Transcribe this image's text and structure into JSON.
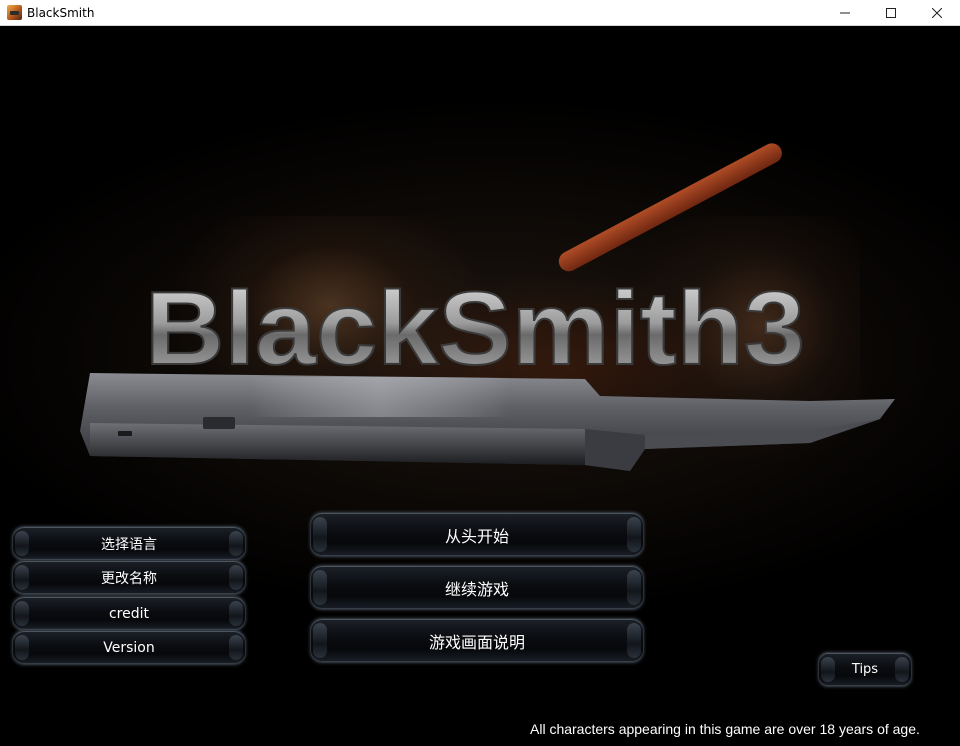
{
  "window": {
    "title": "BlackSmith",
    "app_icon": "blacksmith-app-icon",
    "controls": {
      "minimize_icon": "minimize-icon",
      "maximize_icon": "maximize-icon",
      "close_icon": "close-icon"
    }
  },
  "game": {
    "logo": "BlackSmith3",
    "left_menu": [
      {
        "label": "选择语言"
      },
      {
        "label": "更改名称"
      },
      {
        "label": "credit"
      },
      {
        "label": "Version"
      }
    ],
    "main_menu": [
      {
        "label": "从头开始"
      },
      {
        "label": "继续游戏"
      },
      {
        "label": "游戏画面说明"
      }
    ],
    "tips_label": "Tips",
    "disclaimer": "All characters appearing in this game are over 18 years of age."
  },
  "colors": {
    "background": "#000000",
    "button_text": "#ffffff",
    "logo_metal": "#9a9a9a"
  }
}
